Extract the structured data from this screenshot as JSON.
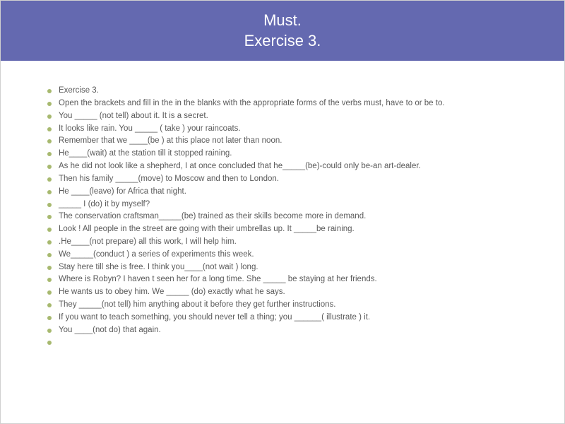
{
  "title_line1": "Must.",
  "title_line2": "Exercise 3.",
  "items": [
    "Exercise 3.",
    "Open the brackets and fill in the in the blanks with the appropriate forms of the verbs must, have to or be to.",
    "You _____ (not tell) about it. It is a secret.",
    " It looks like rain. You _____ ( take ) your raincoats.",
    " Remember that we ____(be ) at this place not later than noon.",
    " He____(wait) at the station till it stopped raining.",
    " As he did not look like a shepherd, I at once concluded that he_____(be)-could only be-an art-dealer.",
    "Then his family _____(move) to Moscow and then to London.",
    " He ____(leave) for Africa that night.",
    " _____ I (do) it by myself?",
    " The conservation craftsman_____(be) trained as their skills become more in demand.",
    " Look !  All people in the street are going with their umbrellas up. It _____be raining.",
    ".He____(not prepare) all this work, I will help him.",
    " We_____(conduct ) a series of experiments this week.",
    " Stay here till she is free. I think you____(not wait )   long.",
    " Where is Robyn? I haven t seen her for a long time. She _____  be staying at her friends.",
    " He wants us to obey him. We _____ (do) exactly what he says.",
    " They _____(not tell) him anything about it before they get further instructions.",
    "If you want to teach something, you should never tell a thing; you ______( illustrate ) it.",
    " You ____(not do) that again.",
    ""
  ]
}
